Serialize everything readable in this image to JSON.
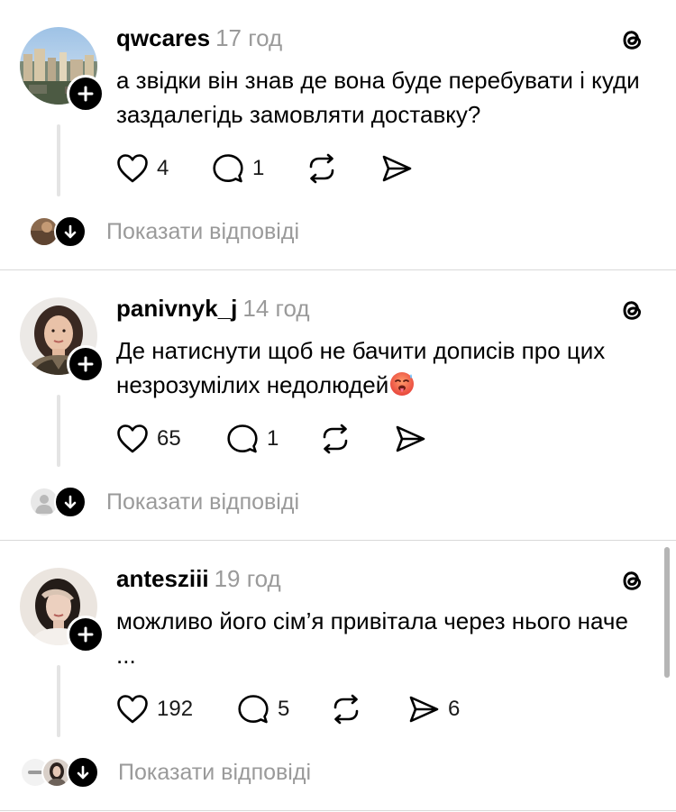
{
  "posts": [
    {
      "username": "qwcares",
      "time": "17 год",
      "text": "а звідки він знав де вона буде перебувати і куди заздалегідь замовляти доставку?",
      "likes": "4",
      "comments": "1",
      "reposts": "",
      "shares": "",
      "show_replies": "Показати відповіді",
      "avatar_icon": "city-photo-avatar"
    },
    {
      "username": "panivnyk_j",
      "time": "14 год",
      "text": "Де натиснути щоб не бачити дописів про цих незрозумілих недолюдей",
      "emoji": "hot-face-emoji",
      "likes": "65",
      "comments": "1",
      "reposts": "",
      "shares": "",
      "show_replies": "Показати відповіді",
      "avatar_icon": "woman-photo-avatar"
    },
    {
      "username": "antesziii",
      "time": "19 год",
      "text": "можливо його сім’я привітала через нього наче ...",
      "likes": "192",
      "comments": "5",
      "reposts": "",
      "shares": "6",
      "show_replies": "Показати відповіді",
      "avatar_icon": "girl-photo-avatar"
    }
  ],
  "colors": {
    "text": "#000000",
    "muted": "#9a9a9a",
    "divider": "#d9d9d9",
    "thread_line": "#e4e4e4"
  },
  "icons": {
    "like": "heart-icon",
    "comment": "comment-bubble-icon",
    "repost": "repost-icon",
    "share": "send-icon",
    "brand": "threads-logo-icon",
    "follow": "plus-icon",
    "expand": "arrow-down-icon"
  }
}
